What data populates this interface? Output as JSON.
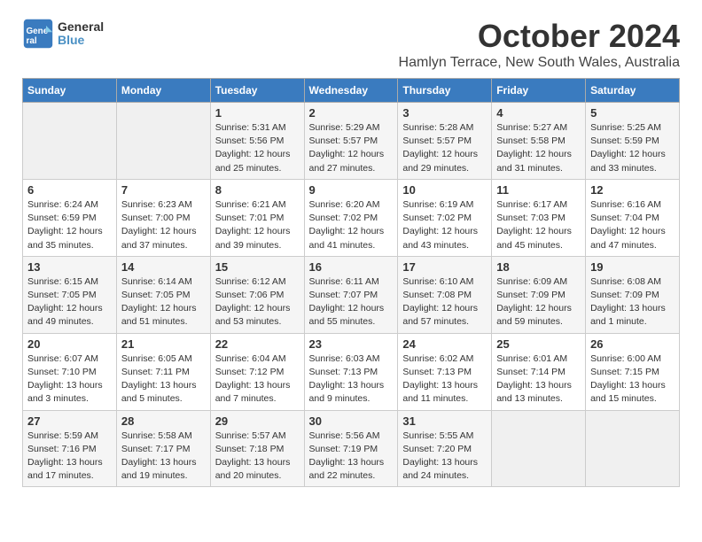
{
  "header": {
    "logo": {
      "line1": "General",
      "line2": "Blue"
    },
    "title": "October 2024",
    "location": "Hamlyn Terrace, New South Wales, Australia"
  },
  "weekdays": [
    "Sunday",
    "Monday",
    "Tuesday",
    "Wednesday",
    "Thursday",
    "Friday",
    "Saturday"
  ],
  "weeks": [
    [
      {
        "day": "",
        "sunrise": "",
        "sunset": "",
        "daylight": ""
      },
      {
        "day": "",
        "sunrise": "",
        "sunset": "",
        "daylight": ""
      },
      {
        "day": "1",
        "sunrise": "Sunrise: 5:31 AM",
        "sunset": "Sunset: 5:56 PM",
        "daylight": "Daylight: 12 hours and 25 minutes."
      },
      {
        "day": "2",
        "sunrise": "Sunrise: 5:29 AM",
        "sunset": "Sunset: 5:57 PM",
        "daylight": "Daylight: 12 hours and 27 minutes."
      },
      {
        "day": "3",
        "sunrise": "Sunrise: 5:28 AM",
        "sunset": "Sunset: 5:57 PM",
        "daylight": "Daylight: 12 hours and 29 minutes."
      },
      {
        "day": "4",
        "sunrise": "Sunrise: 5:27 AM",
        "sunset": "Sunset: 5:58 PM",
        "daylight": "Daylight: 12 hours and 31 minutes."
      },
      {
        "day": "5",
        "sunrise": "Sunrise: 5:25 AM",
        "sunset": "Sunset: 5:59 PM",
        "daylight": "Daylight: 12 hours and 33 minutes."
      }
    ],
    [
      {
        "day": "6",
        "sunrise": "Sunrise: 6:24 AM",
        "sunset": "Sunset: 6:59 PM",
        "daylight": "Daylight: 12 hours and 35 minutes."
      },
      {
        "day": "7",
        "sunrise": "Sunrise: 6:23 AM",
        "sunset": "Sunset: 7:00 PM",
        "daylight": "Daylight: 12 hours and 37 minutes."
      },
      {
        "day": "8",
        "sunrise": "Sunrise: 6:21 AM",
        "sunset": "Sunset: 7:01 PM",
        "daylight": "Daylight: 12 hours and 39 minutes."
      },
      {
        "day": "9",
        "sunrise": "Sunrise: 6:20 AM",
        "sunset": "Sunset: 7:02 PM",
        "daylight": "Daylight: 12 hours and 41 minutes."
      },
      {
        "day": "10",
        "sunrise": "Sunrise: 6:19 AM",
        "sunset": "Sunset: 7:02 PM",
        "daylight": "Daylight: 12 hours and 43 minutes."
      },
      {
        "day": "11",
        "sunrise": "Sunrise: 6:17 AM",
        "sunset": "Sunset: 7:03 PM",
        "daylight": "Daylight: 12 hours and 45 minutes."
      },
      {
        "day": "12",
        "sunrise": "Sunrise: 6:16 AM",
        "sunset": "Sunset: 7:04 PM",
        "daylight": "Daylight: 12 hours and 47 minutes."
      }
    ],
    [
      {
        "day": "13",
        "sunrise": "Sunrise: 6:15 AM",
        "sunset": "Sunset: 7:05 PM",
        "daylight": "Daylight: 12 hours and 49 minutes."
      },
      {
        "day": "14",
        "sunrise": "Sunrise: 6:14 AM",
        "sunset": "Sunset: 7:05 PM",
        "daylight": "Daylight: 12 hours and 51 minutes."
      },
      {
        "day": "15",
        "sunrise": "Sunrise: 6:12 AM",
        "sunset": "Sunset: 7:06 PM",
        "daylight": "Daylight: 12 hours and 53 minutes."
      },
      {
        "day": "16",
        "sunrise": "Sunrise: 6:11 AM",
        "sunset": "Sunset: 7:07 PM",
        "daylight": "Daylight: 12 hours and 55 minutes."
      },
      {
        "day": "17",
        "sunrise": "Sunrise: 6:10 AM",
        "sunset": "Sunset: 7:08 PM",
        "daylight": "Daylight: 12 hours and 57 minutes."
      },
      {
        "day": "18",
        "sunrise": "Sunrise: 6:09 AM",
        "sunset": "Sunset: 7:09 PM",
        "daylight": "Daylight: 12 hours and 59 minutes."
      },
      {
        "day": "19",
        "sunrise": "Sunrise: 6:08 AM",
        "sunset": "Sunset: 7:09 PM",
        "daylight": "Daylight: 13 hours and 1 minute."
      }
    ],
    [
      {
        "day": "20",
        "sunrise": "Sunrise: 6:07 AM",
        "sunset": "Sunset: 7:10 PM",
        "daylight": "Daylight: 13 hours and 3 minutes."
      },
      {
        "day": "21",
        "sunrise": "Sunrise: 6:05 AM",
        "sunset": "Sunset: 7:11 PM",
        "daylight": "Daylight: 13 hours and 5 minutes."
      },
      {
        "day": "22",
        "sunrise": "Sunrise: 6:04 AM",
        "sunset": "Sunset: 7:12 PM",
        "daylight": "Daylight: 13 hours and 7 minutes."
      },
      {
        "day": "23",
        "sunrise": "Sunrise: 6:03 AM",
        "sunset": "Sunset: 7:13 PM",
        "daylight": "Daylight: 13 hours and 9 minutes."
      },
      {
        "day": "24",
        "sunrise": "Sunrise: 6:02 AM",
        "sunset": "Sunset: 7:13 PM",
        "daylight": "Daylight: 13 hours and 11 minutes."
      },
      {
        "day": "25",
        "sunrise": "Sunrise: 6:01 AM",
        "sunset": "Sunset: 7:14 PM",
        "daylight": "Daylight: 13 hours and 13 minutes."
      },
      {
        "day": "26",
        "sunrise": "Sunrise: 6:00 AM",
        "sunset": "Sunset: 7:15 PM",
        "daylight": "Daylight: 13 hours and 15 minutes."
      }
    ],
    [
      {
        "day": "27",
        "sunrise": "Sunrise: 5:59 AM",
        "sunset": "Sunset: 7:16 PM",
        "daylight": "Daylight: 13 hours and 17 minutes."
      },
      {
        "day": "28",
        "sunrise": "Sunrise: 5:58 AM",
        "sunset": "Sunset: 7:17 PM",
        "daylight": "Daylight: 13 hours and 19 minutes."
      },
      {
        "day": "29",
        "sunrise": "Sunrise: 5:57 AM",
        "sunset": "Sunset: 7:18 PM",
        "daylight": "Daylight: 13 hours and 20 minutes."
      },
      {
        "day": "30",
        "sunrise": "Sunrise: 5:56 AM",
        "sunset": "Sunset: 7:19 PM",
        "daylight": "Daylight: 13 hours and 22 minutes."
      },
      {
        "day": "31",
        "sunrise": "Sunrise: 5:55 AM",
        "sunset": "Sunset: 7:20 PM",
        "daylight": "Daylight: 13 hours and 24 minutes."
      },
      {
        "day": "",
        "sunrise": "",
        "sunset": "",
        "daylight": ""
      },
      {
        "day": "",
        "sunrise": "",
        "sunset": "",
        "daylight": ""
      }
    ]
  ]
}
